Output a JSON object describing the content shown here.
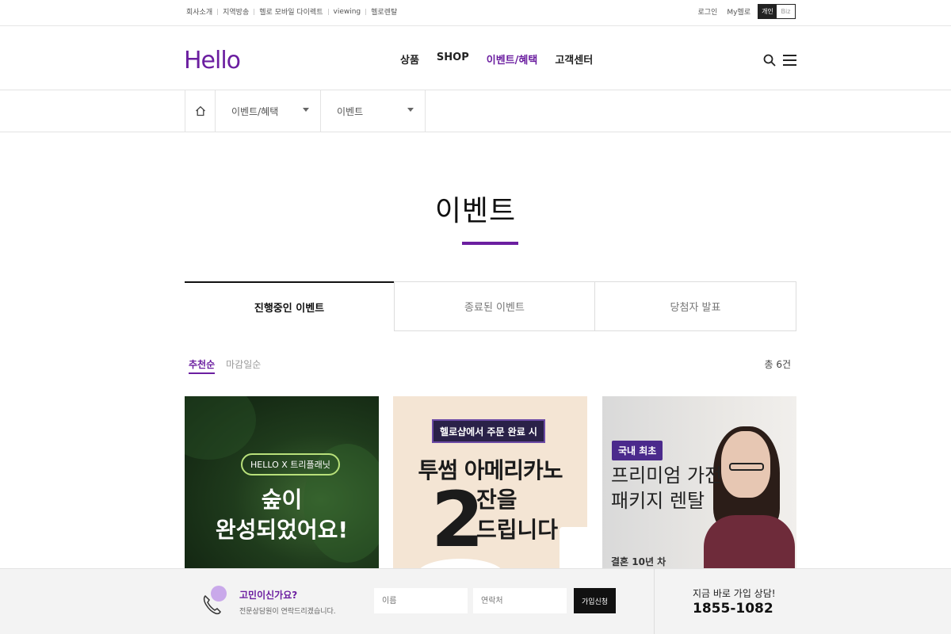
{
  "util_left": [
    "회사소개",
    "지역방송",
    "헬로 모바일 다이렉트",
    "viewing",
    "헬로렌탈"
  ],
  "util_right": {
    "login": "로그인",
    "my": "My헬로",
    "seg_personal": "개인",
    "seg_biz": "Biz"
  },
  "header": {
    "logo": "Hello",
    "nav": [
      "상품",
      "SHOP",
      "이벤트/혜택",
      "고객센터"
    ],
    "active_nav_index": 2,
    "accent_color": "#6b1ea0"
  },
  "breadcrumb": {
    "select1": "이벤트/혜택",
    "select2": "이벤트"
  },
  "page": {
    "title": "이벤트"
  },
  "tabs": [
    "진행중인 이벤트",
    "종료된 이벤트",
    "당첨자 발표"
  ],
  "sort": {
    "recommended": "추천순",
    "deadline": "마감일순",
    "total": "총 6건"
  },
  "cards": [
    {
      "badge": "HELLO X 트리플래닛",
      "line1": "숲이",
      "line2": "완성되었어요!"
    },
    {
      "label": "헬로샵에서 주문 완료 시",
      "headline": "투썸 아메리카노",
      "big_number": "2",
      "sub1": "잔을",
      "sub2": "드립니다"
    },
    {
      "badge": "국내 최초",
      "line1": "프리미엄 가전",
      "line2": "패키지 렌탈",
      "sub": "결혼 10년 차"
    }
  ],
  "consult": {
    "question": "고민이신가요?",
    "desc": "전문상담원이 연락드리겠습니다.",
    "name_placeholder": "이름",
    "tel_placeholder": "연락처",
    "submit": "가입신청",
    "call_label": "지금 바로 가입 상담!",
    "call_number": "1855-1082"
  }
}
